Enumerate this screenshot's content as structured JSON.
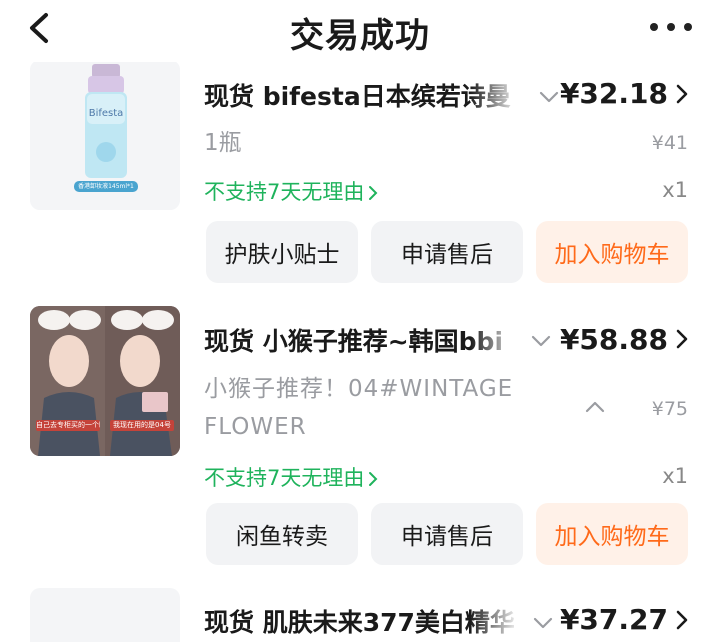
{
  "header": {
    "title": "交易成功",
    "back_icon": "chevron-left-icon",
    "more_icon": "more-dots-icon"
  },
  "items": [
    {
      "name": "现货 bifesta日本缤若诗曼",
      "price": "¥32.18",
      "spec": "1瓶",
      "original_price": "¥41",
      "policy": "不支持7天无理由",
      "quantity": "x1",
      "image_caption": "香港卸妆液145ml*1",
      "buttons": [
        "护肤小贴士",
        "申请售后",
        "加入购物车"
      ]
    },
    {
      "name": "现货 小猴子推荐~韩国bbi",
      "price": "¥58.88",
      "spec": "小猴子推荐！04#WINTAGE FLOWER",
      "original_price": "¥75",
      "policy": "不支持7天无理由",
      "quantity": "x1",
      "image_caption_left": "自己去专柜买的一个眼影盘",
      "image_caption_right": "我现在用的是04号",
      "buttons": [
        "闲鱼转卖",
        "申请售后",
        "加入购物车"
      ]
    },
    {
      "name": "现货 肌肤未来377美白精华",
      "price": "¥37.27"
    }
  ],
  "colors": {
    "accent": "#ff6a1a",
    "policy_green": "#1fb35c",
    "button_bg": "#f2f3f5",
    "cart_bg": "#fff1e8"
  }
}
